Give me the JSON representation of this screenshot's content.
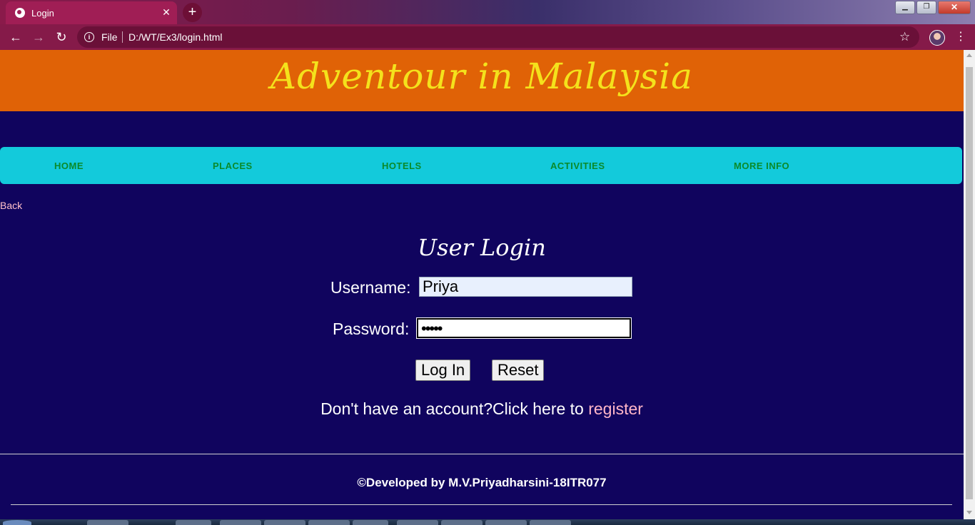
{
  "browser": {
    "tab_title": "Login",
    "tab_close": "✕",
    "new_tab": "+",
    "omnibox_scheme": "File",
    "url": "D:/WT/Ex3/login.html"
  },
  "site": {
    "banner_title": "Adventour in Malaysia",
    "nav": [
      "HOME",
      "PLACES",
      "HOTELS",
      "ACTIVITIES",
      "MORE INFO"
    ],
    "back_link": "Back"
  },
  "login": {
    "title": "User Login",
    "username_label": "Username:",
    "username_value": "Priya",
    "password_label": "Password:",
    "password_value": "•••••",
    "login_button": "Log In",
    "reset_button": "Reset",
    "register_prompt": "Don't have an account?Click here to ",
    "register_link": "register"
  },
  "footer": {
    "text": "©Developed by M.V.Priyadharsini-18ITR077"
  },
  "colors": {
    "page_bg": "#10045e",
    "banner_bg": "#e06206",
    "banner_text": "#f4e21c",
    "nav_bg": "#13cadb",
    "nav_text": "#0a8a2a",
    "link": "#ffb6c8",
    "browser_frame": "#851a49"
  }
}
